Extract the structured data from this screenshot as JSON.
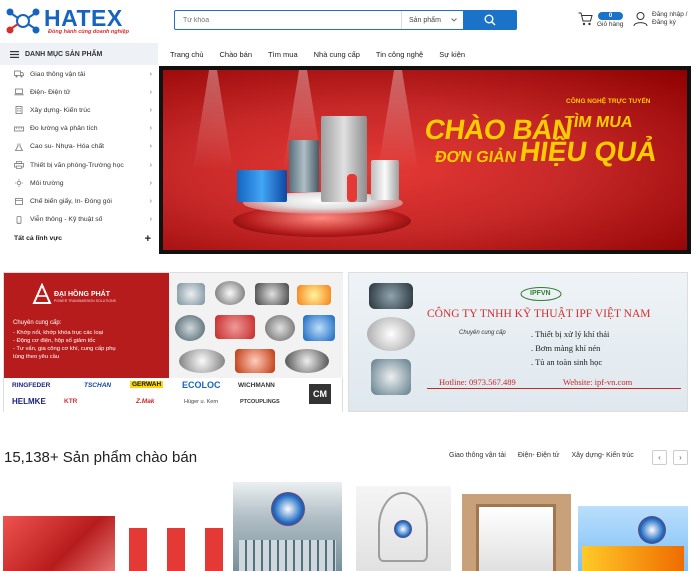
{
  "header": {
    "logo_text": "HATEX",
    "logo_tagline": "Đồng hành cùng doanh nghiệp",
    "search": {
      "placeholder": "Từ khóa",
      "category": "Sản phẩm"
    },
    "cart": {
      "count": "0",
      "label": "Giỏ hàng"
    },
    "user": {
      "line1": "Đăng nhập /",
      "line2": "Đăng ký"
    }
  },
  "catbar": {
    "label": "DANH MỤC SẢN PHẨM"
  },
  "nav": [
    "Trang chủ",
    "Chào bán",
    "Tìm mua",
    "Nhà cung cấp",
    "Tin công nghệ",
    "Sự kiện"
  ],
  "sidebar": {
    "items": [
      {
        "label": "Giao thông vận tải",
        "icon": "truck-icon"
      },
      {
        "label": "Điện- Điện tử",
        "icon": "laptop-icon"
      },
      {
        "label": "Xây dựng- Kiến trúc",
        "icon": "building-icon"
      },
      {
        "label": "Đo lường và phân tích",
        "icon": "ruler-icon"
      },
      {
        "label": "Cao su- Nhựa- Hóa chất",
        "icon": "flask-icon"
      },
      {
        "label": "Thiết bị văn phòng-Trường học",
        "icon": "printer-icon"
      },
      {
        "label": "Môi trường",
        "icon": "sun-icon"
      },
      {
        "label": "Chế biến giấy, In- Đóng gói",
        "icon": "box-icon"
      },
      {
        "label": "Viễn thông - Kỹ thuật số",
        "icon": "phone-icon"
      }
    ],
    "all_label": "Tất cả lĩnh vực"
  },
  "hero": {
    "line1": "CHÀO BÁN",
    "tag": "CÔNG NGHỆ TRỰC TUYẾN",
    "line1b": "TÌM MUA",
    "line2": "ĐƠN GIẢN",
    "line2b": "HIỆU QUẢ"
  },
  "ad1": {
    "brand": "ĐẠI HỒNG PHÁT",
    "brand_sub": "POWER TRANSMISSION SOLUTIONS",
    "provide": "Chuyên cung cấp:",
    "bullets": [
      "- Khớp nối, khớp khóa trục các loại",
      "- Động cơ điện, hộp số giảm tốc",
      "- Tư vấn, gia công cơ khí, cung cấp phụ",
      "  tùng theo yêu cầu"
    ],
    "brands": [
      "RINGFEDER",
      "TSCHAN",
      "GERWAH",
      "ECOLOC",
      "WICHMANN",
      "HELMKE",
      "KTR",
      "Z.Mak",
      "Hüger u. Kern",
      "PTCOUPLINGS",
      "CM"
    ]
  },
  "ad2": {
    "logo": "IPFVN",
    "title": "CÔNG TY TNHH KỸ THUẬT IPF  VIỆT NAM",
    "provide": "Chuyên cung cấp",
    "items": [
      ". Thiết bị xử lý khí thải",
      ". Bơm màng khí nén",
      ". Tủ an toàn sinh học"
    ],
    "hotline": "Hotline: 0973.567.489",
    "website": "Website: ipf-vn.com"
  },
  "products": {
    "title": "15,138+ Sản phẩm chào bán",
    "tabs": [
      "Giao thông vận tải",
      "Điện- Điện tử",
      "Xây dựng- Kiến trúc"
    ],
    "prev": "‹",
    "next": "›"
  },
  "colors": {
    "brand_blue": "#1a73c9",
    "hero_red": "#c62828",
    "hero_yellow": "#ffcc00"
  }
}
